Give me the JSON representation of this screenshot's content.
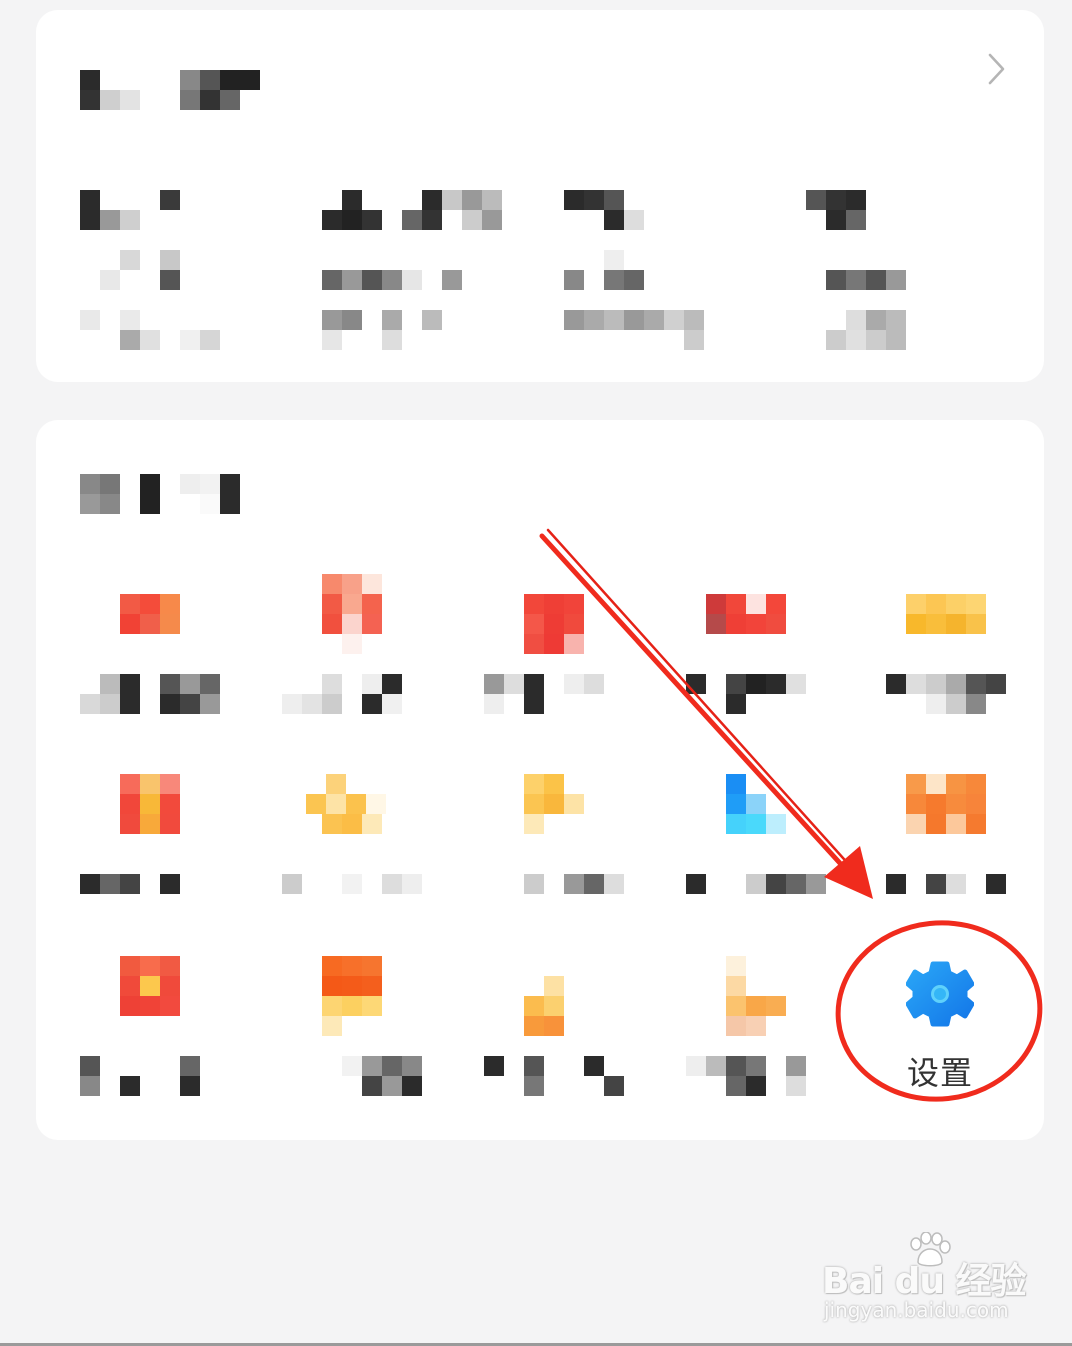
{
  "settings": {
    "label": "设置"
  },
  "watermark": {
    "brand_text": "Bai du 经验",
    "url": "jingyan.baidu.com"
  },
  "colors": {
    "accent_blue": "#1e8ff0",
    "annotation_red": "#f02b1d"
  },
  "icons": {
    "top_card_arrow": "chevron-right-icon",
    "settings": "gear-icon",
    "watermark_logo": "paw-icon"
  }
}
